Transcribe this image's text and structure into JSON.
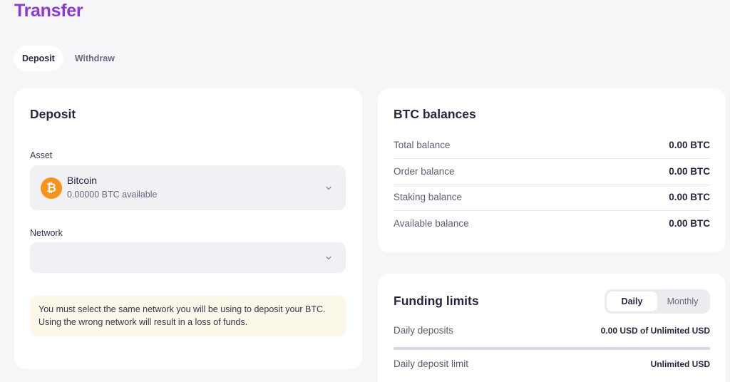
{
  "page": {
    "title": "Transfer"
  },
  "tabs": [
    {
      "label": "Deposit",
      "active": true
    },
    {
      "label": "Withdraw",
      "active": false
    }
  ],
  "deposit": {
    "title": "Deposit",
    "asset_label": "Asset",
    "asset": {
      "name": "Bitcoin",
      "available": "0.00000 BTC available",
      "icon": "bitcoin-icon",
      "icon_glyph": "₿",
      "icon_color": "#f7931a"
    },
    "network_label": "Network",
    "network_value": "",
    "warning": "You must select the same network you will be using to deposit your BTC. Using the wrong network will result in a loss of funds."
  },
  "balances": {
    "title": "BTC balances",
    "rows": [
      {
        "label": "Total balance",
        "value": "0.00 BTC"
      },
      {
        "label": "Order balance",
        "value": "0.00 BTC"
      },
      {
        "label": "Staking balance",
        "value": "0.00 BTC"
      },
      {
        "label": "Available balance",
        "value": "0.00 BTC"
      }
    ]
  },
  "limits": {
    "title": "Funding limits",
    "periods": [
      {
        "label": "Daily",
        "active": true
      },
      {
        "label": "Monthly",
        "active": false
      }
    ],
    "daily_deposits_label": "Daily deposits",
    "daily_deposits_value": "0.00 USD of Unlimited USD",
    "usage_fraction": 0,
    "daily_limit_label": "Daily deposit limit",
    "daily_limit_value": "Unlimited USD"
  },
  "colors": {
    "accent": "#8a3ad6",
    "background": "#f6f5f8",
    "card": "#ffffff",
    "warning_bg": "#fbf7e9"
  }
}
